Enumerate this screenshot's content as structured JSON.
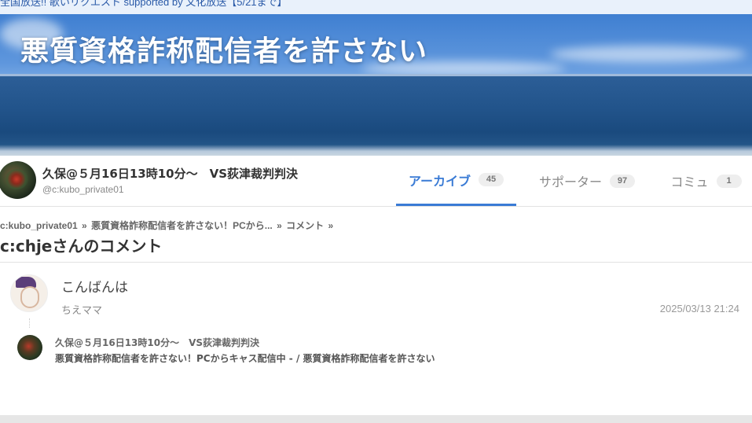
{
  "topbar": {
    "text": "全国放送!! 歌いリクエスト supported by 文化放送【5/21まで】"
  },
  "banner": {
    "title": "悪質資格詐称配信者を許さない"
  },
  "profile": {
    "name": "久保@５月16日13時10分～　VS荻津裁判判決",
    "id": "@c:kubo_private01"
  },
  "tabs": [
    {
      "label": "アーカイブ",
      "count": "45",
      "active": true
    },
    {
      "label": "サポーター",
      "count": "97",
      "active": false
    },
    {
      "label": "コミュ",
      "count": "1",
      "active": false
    }
  ],
  "breadcrumb": {
    "item1": "c:kubo_private01",
    "sep1": " » ",
    "item2": "悪質資格詐称配信者を許さない！PCから...",
    "sep2": " » ",
    "item3": "コメント",
    "sep3": " »"
  },
  "page_title": "c:chjeさんのコメント",
  "comment": {
    "text": "こんばんは",
    "author": "ちえママ",
    "date": "2025/03/13 21:24"
  },
  "reply": {
    "name": "久保@５月16日13時10分～　VS荻津裁判判決",
    "link": "悪質資格詐称配信者を許さない！PCからキャス配信中 - / 悪質資格詐称配信者を許さない"
  },
  "colors": {
    "accent": "#3a7bd5"
  }
}
